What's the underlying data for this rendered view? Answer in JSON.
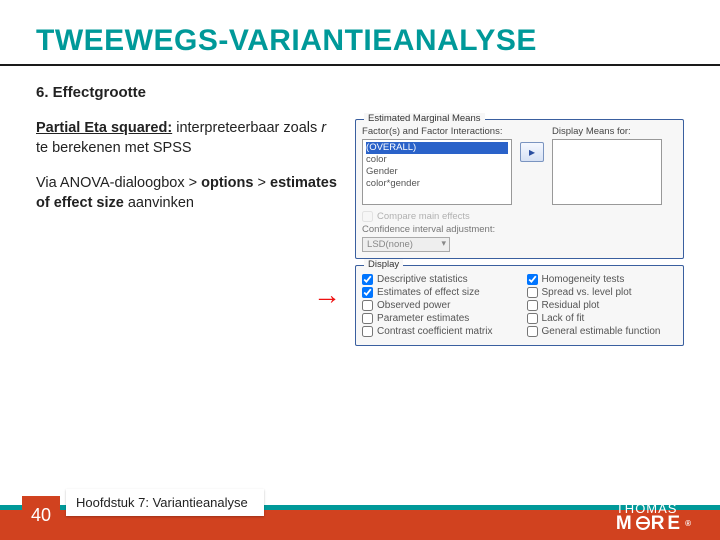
{
  "title": "TWEEWEGS-VARIANTIEANALYSE",
  "section_heading": "6. Effectgrootte",
  "body": {
    "p1_lead": "Partial Eta squared:",
    "p1_rest": " interpreteerbaar zoals ",
    "p1_r": "r",
    "p1_line2": "te berekenen met SPSS",
    "p2_a": "Via ANOVA-dialoogbox > ",
    "p2_b": "options",
    "p2_c": " > ",
    "p2_d": "estimates of effect size",
    "p2_e": " aanvinken"
  },
  "dialog": {
    "em_panel_label": "Estimated Marginal Means",
    "factors_label": "Factor(s) and Factor Interactions:",
    "display_label": "Display Means for:",
    "factor_items": [
      "(OVERALL)",
      "color",
      "Gender",
      "color*gender"
    ],
    "compare_label": "Compare main effects",
    "ci_label": "Confidence interval adjustment:",
    "ci_value": "LSD(none)",
    "disp_panel_label": "Display",
    "left_opts": [
      {
        "label": "Descriptive statistics",
        "checked": true
      },
      {
        "label": "Estimates of effect size",
        "checked": true
      },
      {
        "label": "Observed power",
        "checked": false
      },
      {
        "label": "Parameter estimates",
        "checked": false
      },
      {
        "label": "Contrast coefficient matrix",
        "checked": false
      }
    ],
    "right_opts": [
      {
        "label": "Homogeneity tests",
        "checked": true
      },
      {
        "label": "Spread vs. level plot",
        "checked": false
      },
      {
        "label": "Residual plot",
        "checked": false
      },
      {
        "label": "Lack of fit",
        "checked": false
      },
      {
        "label": "General estimable function",
        "checked": false
      }
    ]
  },
  "footer": {
    "page": "40",
    "chapter": "Hoofdstuk 7: Variantieanalyse",
    "logo_top": "THOMAS",
    "logo_bottom_a": "M",
    "logo_bottom_b": "RE"
  }
}
